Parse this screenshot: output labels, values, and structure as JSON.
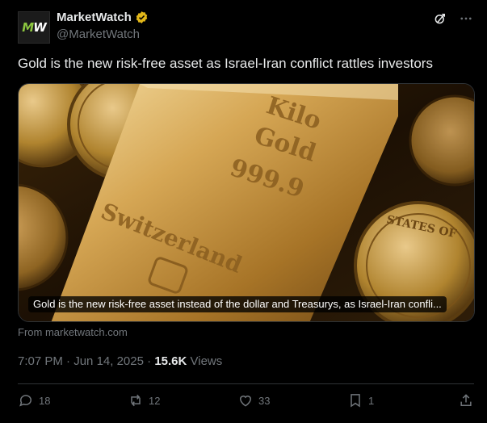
{
  "account": {
    "avatar_text_m": "M",
    "avatar_text_w": "W",
    "display_name": "MarketWatch",
    "handle": "@MarketWatch",
    "verified": true,
    "brand_color": "#8cc63f"
  },
  "top_icons": [
    "grok-icon",
    "more-icon"
  ],
  "tweet": {
    "text": "Gold is the new risk-free asset as Israel-Iran conflict rattles investors"
  },
  "card": {
    "caption": "Gold is the new risk-free asset instead of the dollar and Treasurys, as Israel-Iran confli...",
    "source": "From marketwatch.com",
    "image_text": {
      "bar_line1": "Kilo",
      "bar_line2": "Gold",
      "bar_line3": "999.9",
      "bar_origin": "Switzerland",
      "coin_text": "STATES OF"
    }
  },
  "meta": {
    "time": "7:07 PM",
    "separator1": " · ",
    "date": "Jun 14, 2025",
    "separator2": " · ",
    "views_count": "15.6K",
    "views_label": " Views"
  },
  "actions": {
    "replies": "18",
    "reposts": "12",
    "likes": "33",
    "bookmarks": "1"
  },
  "colors": {
    "background": "#000000",
    "text": "#e7e9ea",
    "muted": "#71767b",
    "divider": "#2f3336",
    "verified_gold": "#e2b719"
  }
}
